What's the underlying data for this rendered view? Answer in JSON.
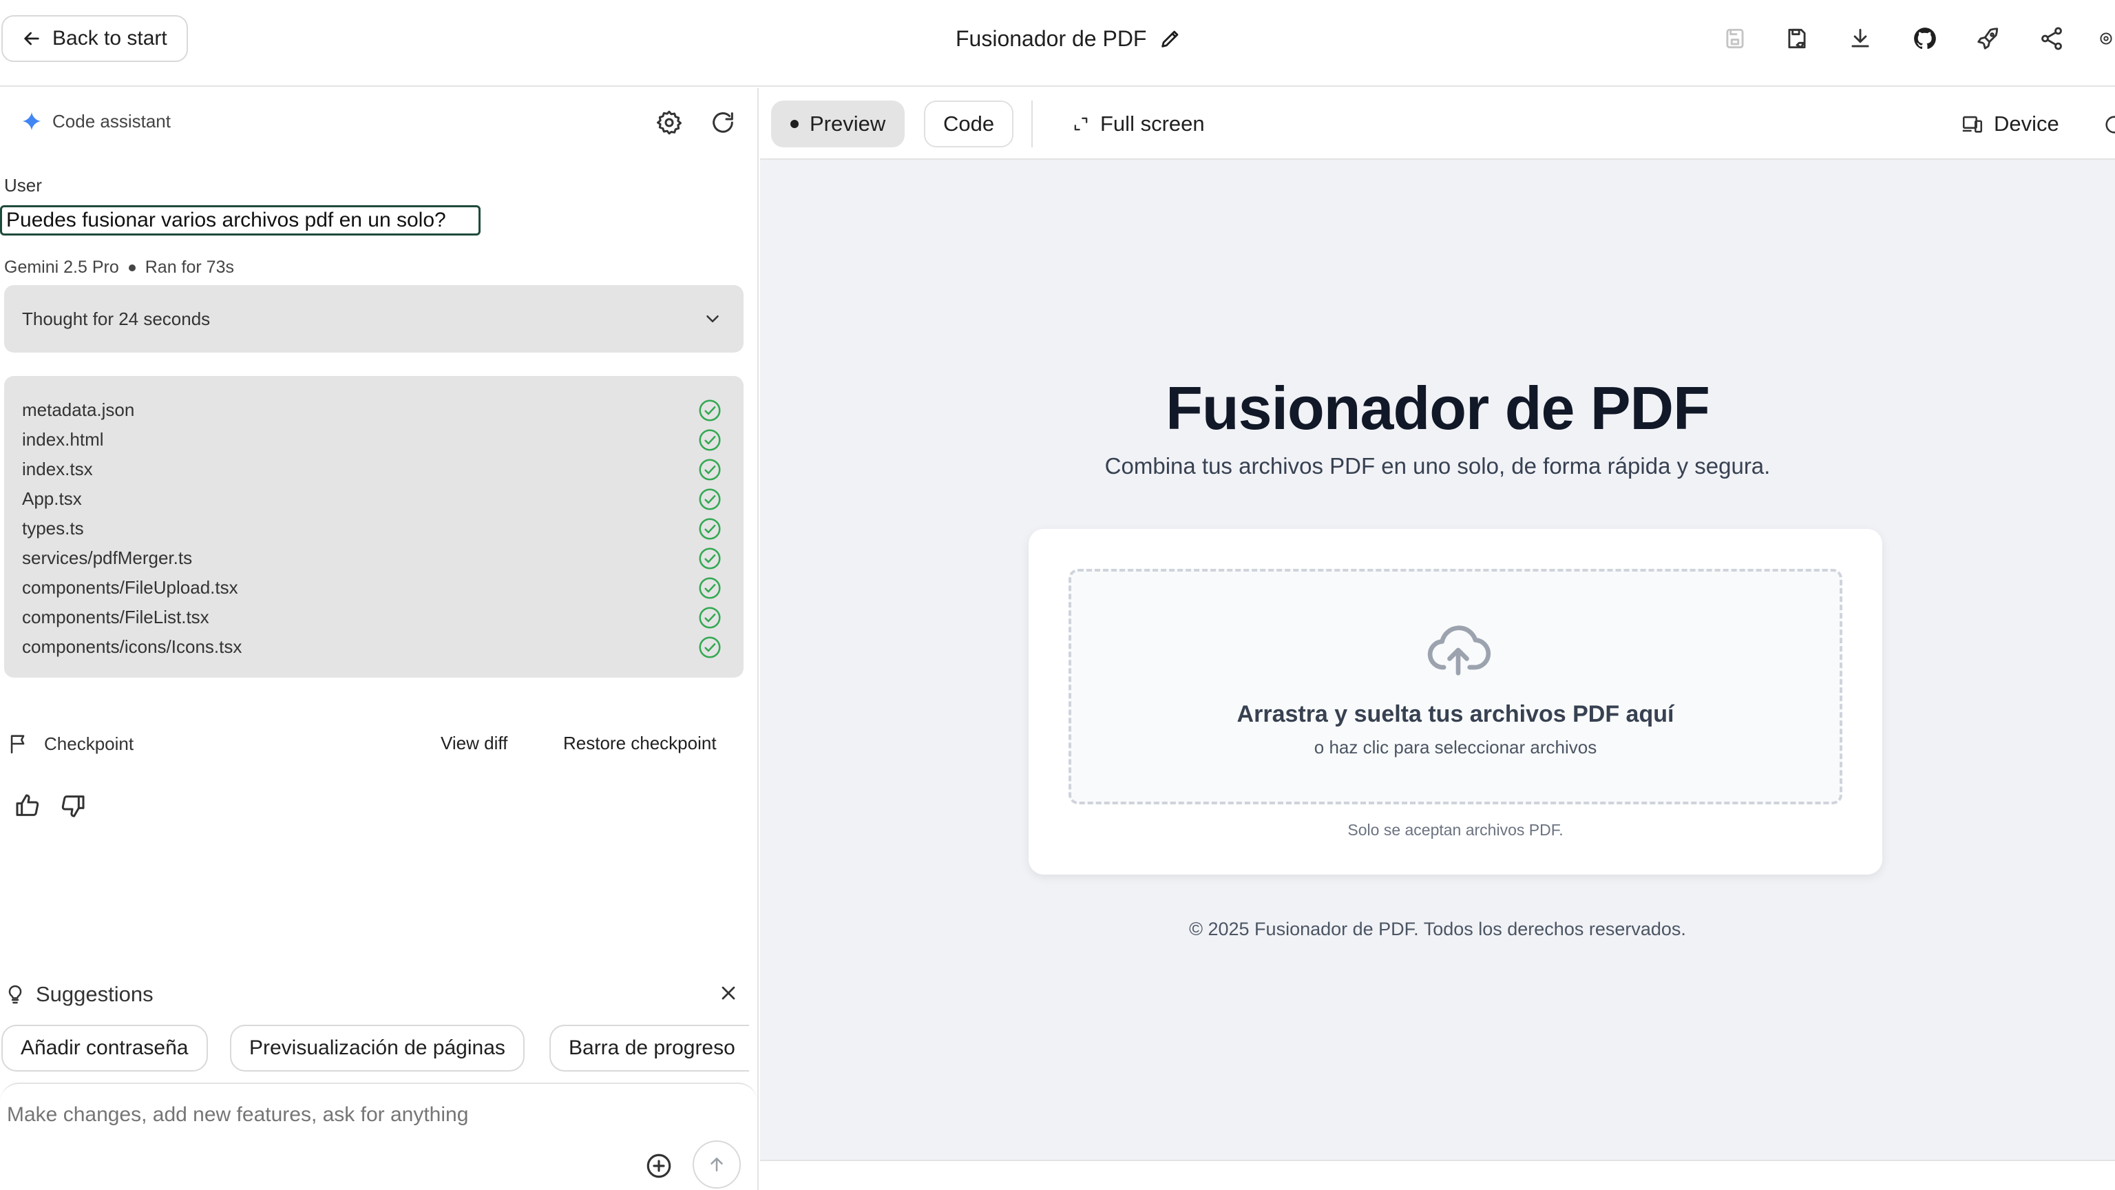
{
  "header": {
    "back_label": "Back to start",
    "app_title": "Fusionador de PDF",
    "icons": [
      "save-disabled-icon",
      "save-as-icon",
      "download-icon",
      "github-icon",
      "deploy-rocket-icon",
      "share-icon"
    ]
  },
  "assistant": {
    "label": "Code assistant",
    "user_role": "User",
    "user_message": "Puedes fusionar varios archivos pdf en un solo?",
    "model": "Gemini 2.5 Pro",
    "run_time": "Ran for 73s",
    "thought": "Thought for 24 seconds",
    "files": [
      "metadata.json",
      "index.html",
      "index.tsx",
      "App.tsx",
      "types.ts",
      "services/pdfMerger.ts",
      "components/FileUpload.tsx",
      "components/FileList.tsx",
      "components/icons/Icons.tsx"
    ],
    "checkpoint_label": "Checkpoint",
    "view_diff": "View diff",
    "restore_checkpoint": "Restore checkpoint"
  },
  "suggestions": {
    "label": "Suggestions",
    "chips": [
      "Añadir contraseña",
      "Previsualización de páginas",
      "Barra de progreso"
    ]
  },
  "composer": {
    "placeholder": "Make changes, add new features, ask for anything"
  },
  "toolbar": {
    "preview": "Preview",
    "code": "Code",
    "full_screen": "Full screen",
    "device": "Device"
  },
  "preview": {
    "title": "Fusionador de PDF",
    "subtitle": "Combina tus archivos PDF en uno solo, de forma rápida y segura.",
    "drop_main": "Arrastra y suelta tus archivos PDF aquí",
    "drop_sub": "o haz clic para seleccionar archivos",
    "note": "Solo se aceptan archivos PDF.",
    "footer": "© 2025 Fusionador de PDF. Todos los derechos reservados."
  },
  "colors": {
    "accent_blue": "#4285f4",
    "success_green": "#34a853",
    "focus_border": "#1e4a3b",
    "preview_bg": "#f1f2f6"
  }
}
